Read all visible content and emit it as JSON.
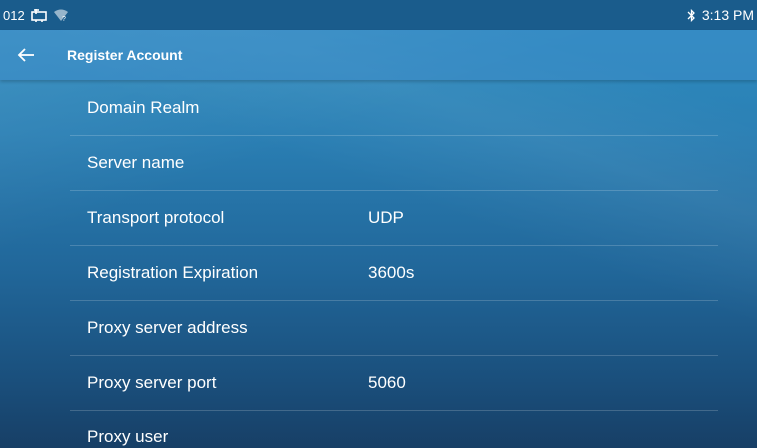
{
  "status_bar": {
    "left_text": "012",
    "time": "3:13 PM"
  },
  "header": {
    "title": "Register Account"
  },
  "settings": [
    {
      "label": "Domain Realm",
      "value": ""
    },
    {
      "label": "Server name",
      "value": ""
    },
    {
      "label": "Transport protocol",
      "value": "UDP"
    },
    {
      "label": "Registration Expiration",
      "value": "3600s"
    },
    {
      "label": "Proxy server address",
      "value": ""
    },
    {
      "label": "Proxy server port",
      "value": "5060"
    },
    {
      "label": "Proxy user",
      "value": ""
    }
  ],
  "colors": {
    "status_bar": "#1a5c8c",
    "background_top": "#2f8fc2",
    "background_bottom": "#173f66",
    "text": "#ffffff"
  },
  "icons": [
    "screen-share-icon",
    "wifi-icon",
    "bluetooth-icon",
    "back-arrow-icon"
  ]
}
